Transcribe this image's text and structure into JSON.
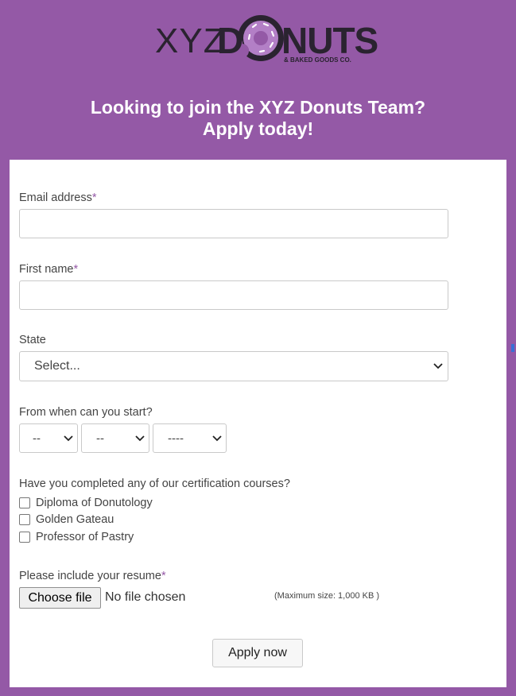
{
  "logo": {
    "xyz": "XYZ",
    "d": "D",
    "nuts": "NUTS",
    "tagline": "& BAKED GOODS CO."
  },
  "headline": {
    "line1": "Looking to join the XYZ Donuts Team?",
    "line2": "Apply today!"
  },
  "form": {
    "email": {
      "label": "Email address",
      "required_mark": "*",
      "value": "",
      "placeholder": ""
    },
    "first_name": {
      "label": "First name",
      "required_mark": "*",
      "value": "",
      "placeholder": ""
    },
    "state": {
      "label": "State",
      "selected": "Select..."
    },
    "start": {
      "label": "From when can you start?",
      "day": "--",
      "month": "--",
      "year": "----"
    },
    "certification": {
      "label": "Have you completed any of our certification courses?",
      "options": [
        "Diploma of Donutology",
        "Golden Gateau",
        "Professor of Pastry"
      ]
    },
    "resume": {
      "label": "Please include your resume",
      "required_mark": "*",
      "button": "Choose file",
      "status": "No file chosen",
      "max_size": "(Maximum size: 1,000 KB )"
    },
    "submit": "Apply now"
  },
  "colors": {
    "background": "#9459a6",
    "card": "#ffffff",
    "required": "#9459a6",
    "logo_dark": "#2a2330"
  }
}
